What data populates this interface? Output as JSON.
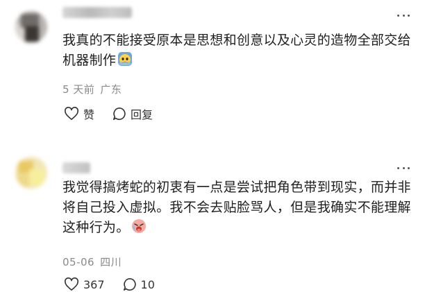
{
  "comments": [
    {
      "text": "我真的不能接受原本是思想和创意以及心灵的造物全部交给机器制作",
      "emoji": "worried-face-emoji",
      "time": "5 天前",
      "location": "广东",
      "like_label": "赞",
      "reply_label": "回复"
    },
    {
      "text": "我觉得搞烤蛇的初衷有一点是尝试把角色带到现实，而并非将自己投入虚拟。我不会去贴脸骂人，但是我确实不能理解这种行为。",
      "emoji": "crying-face-emoji",
      "time": "05-06",
      "location": "四川",
      "like_label": "367",
      "reply_label": "10"
    }
  ],
  "icons": {
    "more": "more-horizontal-icon",
    "like": "heart-outline-icon",
    "reply": "comment-bubble-icon"
  },
  "colors": {
    "text": "#1f1f1f",
    "meta": "#8a8a8a",
    "icon": "#333333"
  }
}
